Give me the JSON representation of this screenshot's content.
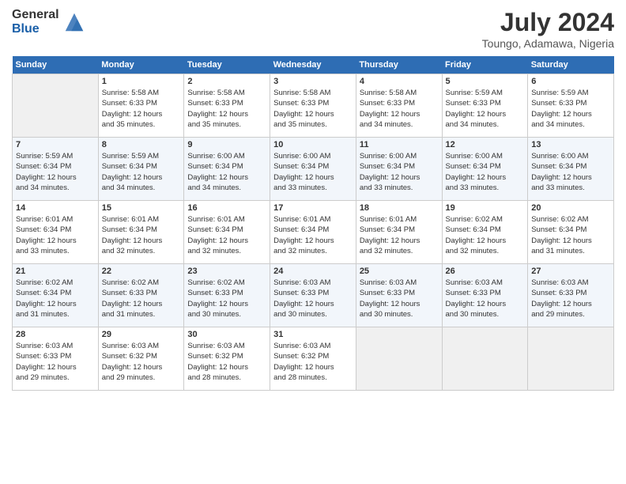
{
  "header": {
    "logo_general": "General",
    "logo_blue": "Blue",
    "month_year": "July 2024",
    "location": "Toungo, Adamawa, Nigeria"
  },
  "days_of_week": [
    "Sunday",
    "Monday",
    "Tuesday",
    "Wednesday",
    "Thursday",
    "Friday",
    "Saturday"
  ],
  "weeks": [
    [
      {
        "day": "",
        "info": ""
      },
      {
        "day": "1",
        "info": "Sunrise: 5:58 AM\nSunset: 6:33 PM\nDaylight: 12 hours\nand 35 minutes."
      },
      {
        "day": "2",
        "info": "Sunrise: 5:58 AM\nSunset: 6:33 PM\nDaylight: 12 hours\nand 35 minutes."
      },
      {
        "day": "3",
        "info": "Sunrise: 5:58 AM\nSunset: 6:33 PM\nDaylight: 12 hours\nand 35 minutes."
      },
      {
        "day": "4",
        "info": "Sunrise: 5:58 AM\nSunset: 6:33 PM\nDaylight: 12 hours\nand 34 minutes."
      },
      {
        "day": "5",
        "info": "Sunrise: 5:59 AM\nSunset: 6:33 PM\nDaylight: 12 hours\nand 34 minutes."
      },
      {
        "day": "6",
        "info": "Sunrise: 5:59 AM\nSunset: 6:33 PM\nDaylight: 12 hours\nand 34 minutes."
      }
    ],
    [
      {
        "day": "7",
        "info": "Sunrise: 5:59 AM\nSunset: 6:34 PM\nDaylight: 12 hours\nand 34 minutes."
      },
      {
        "day": "8",
        "info": "Sunrise: 5:59 AM\nSunset: 6:34 PM\nDaylight: 12 hours\nand 34 minutes."
      },
      {
        "day": "9",
        "info": "Sunrise: 6:00 AM\nSunset: 6:34 PM\nDaylight: 12 hours\nand 34 minutes."
      },
      {
        "day": "10",
        "info": "Sunrise: 6:00 AM\nSunset: 6:34 PM\nDaylight: 12 hours\nand 33 minutes."
      },
      {
        "day": "11",
        "info": "Sunrise: 6:00 AM\nSunset: 6:34 PM\nDaylight: 12 hours\nand 33 minutes."
      },
      {
        "day": "12",
        "info": "Sunrise: 6:00 AM\nSunset: 6:34 PM\nDaylight: 12 hours\nand 33 minutes."
      },
      {
        "day": "13",
        "info": "Sunrise: 6:00 AM\nSunset: 6:34 PM\nDaylight: 12 hours\nand 33 minutes."
      }
    ],
    [
      {
        "day": "14",
        "info": "Sunrise: 6:01 AM\nSunset: 6:34 PM\nDaylight: 12 hours\nand 33 minutes."
      },
      {
        "day": "15",
        "info": "Sunrise: 6:01 AM\nSunset: 6:34 PM\nDaylight: 12 hours\nand 32 minutes."
      },
      {
        "day": "16",
        "info": "Sunrise: 6:01 AM\nSunset: 6:34 PM\nDaylight: 12 hours\nand 32 minutes."
      },
      {
        "day": "17",
        "info": "Sunrise: 6:01 AM\nSunset: 6:34 PM\nDaylight: 12 hours\nand 32 minutes."
      },
      {
        "day": "18",
        "info": "Sunrise: 6:01 AM\nSunset: 6:34 PM\nDaylight: 12 hours\nand 32 minutes."
      },
      {
        "day": "19",
        "info": "Sunrise: 6:02 AM\nSunset: 6:34 PM\nDaylight: 12 hours\nand 32 minutes."
      },
      {
        "day": "20",
        "info": "Sunrise: 6:02 AM\nSunset: 6:34 PM\nDaylight: 12 hours\nand 31 minutes."
      }
    ],
    [
      {
        "day": "21",
        "info": "Sunrise: 6:02 AM\nSunset: 6:34 PM\nDaylight: 12 hours\nand 31 minutes."
      },
      {
        "day": "22",
        "info": "Sunrise: 6:02 AM\nSunset: 6:33 PM\nDaylight: 12 hours\nand 31 minutes."
      },
      {
        "day": "23",
        "info": "Sunrise: 6:02 AM\nSunset: 6:33 PM\nDaylight: 12 hours\nand 30 minutes."
      },
      {
        "day": "24",
        "info": "Sunrise: 6:03 AM\nSunset: 6:33 PM\nDaylight: 12 hours\nand 30 minutes."
      },
      {
        "day": "25",
        "info": "Sunrise: 6:03 AM\nSunset: 6:33 PM\nDaylight: 12 hours\nand 30 minutes."
      },
      {
        "day": "26",
        "info": "Sunrise: 6:03 AM\nSunset: 6:33 PM\nDaylight: 12 hours\nand 30 minutes."
      },
      {
        "day": "27",
        "info": "Sunrise: 6:03 AM\nSunset: 6:33 PM\nDaylight: 12 hours\nand 29 minutes."
      }
    ],
    [
      {
        "day": "28",
        "info": "Sunrise: 6:03 AM\nSunset: 6:33 PM\nDaylight: 12 hours\nand 29 minutes."
      },
      {
        "day": "29",
        "info": "Sunrise: 6:03 AM\nSunset: 6:32 PM\nDaylight: 12 hours\nand 29 minutes."
      },
      {
        "day": "30",
        "info": "Sunrise: 6:03 AM\nSunset: 6:32 PM\nDaylight: 12 hours\nand 28 minutes."
      },
      {
        "day": "31",
        "info": "Sunrise: 6:03 AM\nSunset: 6:32 PM\nDaylight: 12 hours\nand 28 minutes."
      },
      {
        "day": "",
        "info": ""
      },
      {
        "day": "",
        "info": ""
      },
      {
        "day": "",
        "info": ""
      }
    ]
  ]
}
